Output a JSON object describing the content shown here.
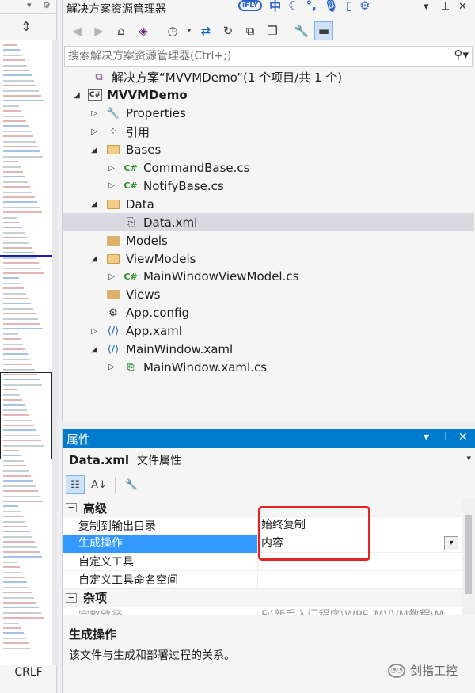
{
  "minimap": {
    "crlf": "CRLF"
  },
  "solution_explorer": {
    "title": "解决方案资源管理器",
    "ime_label": "中",
    "ime_logo": "iFLY",
    "search_placeholder": "搜索解决方案资源管理器(Ctrl+;)",
    "tree": [
      {
        "label": "解决方案“MVVMDemo”(1 个项目/共 1 个)",
        "icon": "solution-icon",
        "indent": 0,
        "arrow": "",
        "bold": false
      },
      {
        "label": "MVVMDemo",
        "icon": "csharp-project-icon",
        "indent": 1,
        "arrow": "open",
        "bold": true
      },
      {
        "label": "Properties",
        "icon": "wrench-icon",
        "indent": 2,
        "arrow": "closed",
        "bold": false
      },
      {
        "label": "引用",
        "icon": "references-icon",
        "indent": 2,
        "arrow": "closed",
        "bold": false
      },
      {
        "label": "Bases",
        "icon": "folder-open-icon",
        "indent": 2,
        "arrow": "open",
        "bold": false
      },
      {
        "label": "CommandBase.cs",
        "icon": "csharp-file-icon",
        "indent": 3,
        "arrow": "closed",
        "bold": false
      },
      {
        "label": "NotifyBase.cs",
        "icon": "csharp-file-icon",
        "indent": 3,
        "arrow": "closed",
        "bold": false
      },
      {
        "label": "Data",
        "icon": "folder-open-icon",
        "indent": 2,
        "arrow": "open",
        "bold": false
      },
      {
        "label": "Data.xml",
        "icon": "xml-file-icon",
        "indent": 3,
        "arrow": "",
        "bold": false,
        "selected": true
      },
      {
        "label": "Models",
        "icon": "folder-icon",
        "indent": 2,
        "arrow": "",
        "bold": false
      },
      {
        "label": "ViewModels",
        "icon": "folder-open-icon",
        "indent": 2,
        "arrow": "open",
        "bold": false
      },
      {
        "label": "MainWindowViewModel.cs",
        "icon": "csharp-file-icon",
        "indent": 3,
        "arrow": "closed",
        "bold": false
      },
      {
        "label": "Views",
        "icon": "folder-icon",
        "indent": 2,
        "arrow": "",
        "bold": false
      },
      {
        "label": "App.config",
        "icon": "config-file-icon",
        "indent": 2,
        "arrow": "",
        "bold": false
      },
      {
        "label": "App.xaml",
        "icon": "xaml-file-icon",
        "indent": 2,
        "arrow": "closed",
        "bold": false
      },
      {
        "label": "MainWindow.xaml",
        "icon": "xaml-file-icon",
        "indent": 2,
        "arrow": "open",
        "bold": false
      },
      {
        "label": "MainWindow.xaml.cs",
        "icon": "csharp-code-file-icon",
        "indent": 3,
        "arrow": "closed",
        "bold": false
      }
    ]
  },
  "properties": {
    "title": "属性",
    "object_name": "Data.xml",
    "object_type": "文件属性",
    "grid": [
      {
        "kind": "category",
        "label": "高级"
      },
      {
        "kind": "prop",
        "name": "复制到输出目录",
        "value": "始终复制"
      },
      {
        "kind": "prop",
        "name": "生成操作",
        "value": "内容",
        "selected": true,
        "dropdown": true
      },
      {
        "kind": "prop",
        "name": "自定义工具",
        "value": ""
      },
      {
        "kind": "prop",
        "name": "自定义工具命名空间",
        "value": ""
      },
      {
        "kind": "category",
        "label": "杂项"
      },
      {
        "kind": "prop",
        "name": "完整路径",
        "value": "F:\\新手入门程序\\WPF_MVVM教程\\M",
        "faded": true
      }
    ],
    "description_title": "生成操作",
    "description_text": "该文件与生成和部署过程的关系。"
  },
  "watermark": "剑指工控"
}
